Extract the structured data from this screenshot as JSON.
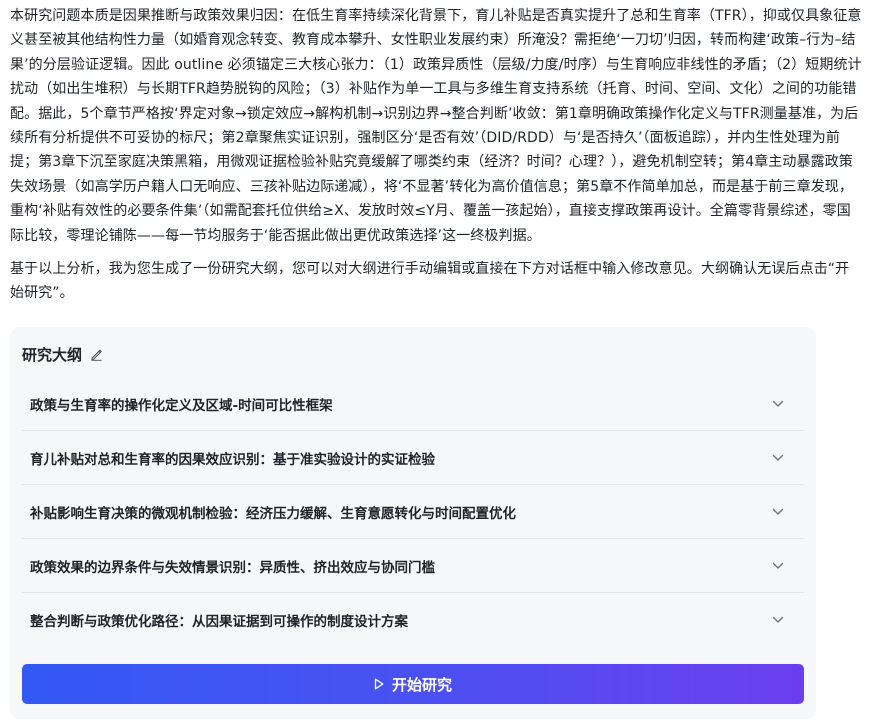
{
  "message": {
    "paragraph1": "本研究问题本质是因果推断与政策效果归因：在低生育率持续深化背景下，育儿补贴是否真实提升了总和生育率（TFR），抑或仅具象征意义甚至被其他结构性力量（如婚育观念转变、教育成本攀升、女性职业发展约束）所淹没？需拒绝‘一刀切’归因，转而构建‘政策–行为–结果’的分层验证逻辑。因此 outline 必须锚定三大核心张力：（1）政策异质性（层级/力度/时序）与生育响应非线性的矛盾；（2）短期统计扰动（如出生堆积）与长期TFR趋势脱钩的风险；（3）补贴作为单一工具与多维生育支持系统（托育、时间、空间、文化）之间的功能错配。据此，5个章节严格按‘界定对象→锁定效应→解构机制→识别边界→整合判断’收敛：第1章明确政策操作化定义与TFR测量基准，为后续所有分析提供不可妥协的标尺；第2章聚焦实证识别，强制区分‘是否有效’（DID/RDD）与‘是否持久’（面板追踪），并内生性处理为前提；第3章下沉至家庭决策黑箱，用微观证据检验补贴究竟缓解了哪类约束（经济？时间？心理？），避免机制空转；第4章主动暴露政策失效场景（如高学历户籍人口无响应、三孩补贴边际递减），将‘不显著’转化为高价值信息；第5章不作简单加总，而是基于前三章发现，重构‘补贴有效性的必要条件集’（如需配套托位供给≥X、发放时效≤Y月、覆盖一孩起始），直接支撑政策再设计。全篇零背景综述，零国际比较，零理论铺陈——每一节均服务于‘能否据此做出更优政策选择’这一终极判据。",
    "paragraph2": "基于以上分析，我为您生成了一份研究大纲，您可以对大纲进行手动编辑或直接在下方对话框中输入修改意见。大纲确认无误后点击“开始研究”。"
  },
  "outline": {
    "title": "研究大纲",
    "items": [
      {
        "label": "政策与生育率的操作化定义及区域-时间可比性框架"
      },
      {
        "label": "育儿补贴对总和生育率的因果效应识别：基于准实验设计的实证检验"
      },
      {
        "label": "补贴影响生育决策的微观机制检验：经济压力缓解、生育意愿转化与时间配置优化"
      },
      {
        "label": "政策效果的边界条件与失效情景识别：异质性、挤出效应与协同门槛"
      },
      {
        "label": "整合判断与政策优化路径：从因果证据到可操作的制度设计方案"
      }
    ]
  },
  "actions": {
    "start_label": "开始研究"
  },
  "icons": {
    "edit": "pencil-icon",
    "expand": "chevron-down-icon",
    "start": "play-icon"
  },
  "colors": {
    "button_gradient_start": "#3358f4",
    "button_gradient_end": "#6b3ef0",
    "card_background": "#f6f7f9"
  }
}
